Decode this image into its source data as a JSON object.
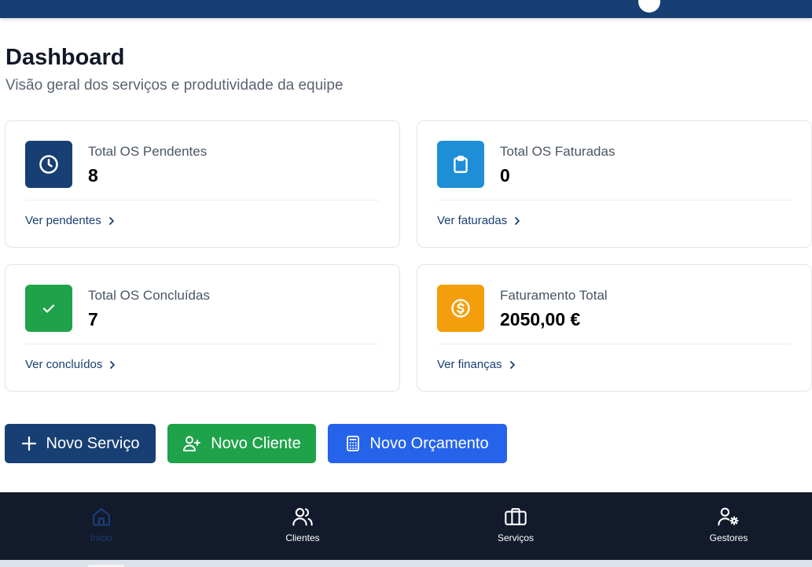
{
  "colors": {
    "topbar": "#173f73",
    "primary": "#173f73",
    "success": "#1fa34a",
    "info": "#2563eb",
    "warning": "#f59e0b",
    "sky": "#1e8fd6",
    "nav_bg": "#121a2b"
  },
  "header": {
    "title": "Dashboard",
    "subtitle": "Visão geral dos serviços e produtividade da equipe"
  },
  "cards": [
    {
      "label": "Total OS Pendentes",
      "value": "8",
      "link": "Ver pendentes",
      "icon": "clock-icon"
    },
    {
      "label": "Total OS Faturadas",
      "value": "0",
      "link": "Ver faturadas",
      "icon": "clipboard-icon"
    },
    {
      "label": "Total OS Concluídas",
      "value": "7",
      "link": "Ver concluídos",
      "icon": "check-icon"
    },
    {
      "label": "Faturamento Total",
      "value": "2050,00 €",
      "link": "Ver finanças",
      "icon": "dollar-circle-icon"
    }
  ],
  "actions": {
    "new_service": "Novo Serviço",
    "new_client": "Novo Cliente",
    "new_quote": "Novo Orçamento"
  },
  "nav": [
    {
      "label": "Início",
      "icon": "home-icon",
      "active": true
    },
    {
      "label": "Clientes",
      "icon": "users-icon",
      "active": false
    },
    {
      "label": "Serviços",
      "icon": "briefcase-icon",
      "active": false
    },
    {
      "label": "Gestores",
      "icon": "user-gear-icon",
      "active": false
    }
  ]
}
